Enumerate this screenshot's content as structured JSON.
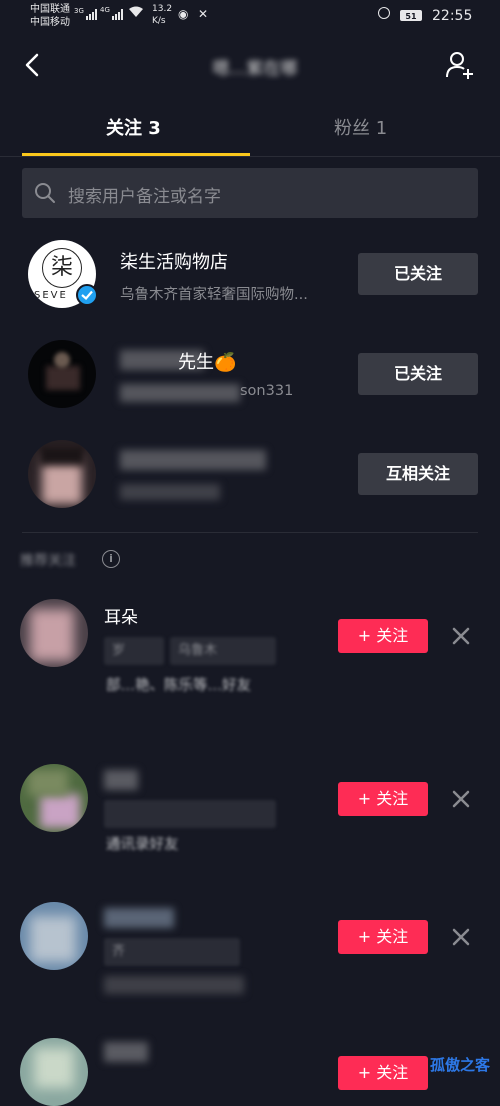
{
  "status_bar": {
    "carrier_1": "中国联通",
    "carrier_2": "中国移动",
    "net_1": "3G",
    "net_2": "4G",
    "speed_value": "13.2",
    "speed_unit": "K/s",
    "battery": "51",
    "time": "22:55"
  },
  "header": {
    "title": "嗯…紫在哪"
  },
  "tabs": {
    "following": "关注 3",
    "fans": "粉丝 1"
  },
  "search": {
    "placeholder": "搜索用户备注或名字"
  },
  "following": [
    {
      "name": "柒生活购物店",
      "subtitle": "乌鲁木齐首家轻奢国际购物...",
      "avatar_text": "柒",
      "avatar_caption": "SEVE",
      "verified": true,
      "button": "已关注"
    },
    {
      "name": "先生🍊",
      "subtitle": "son331",
      "button": "已关注"
    },
    {
      "name": "",
      "subtitle": "",
      "button": "互相关注"
    }
  ],
  "recommend": {
    "title": "推荐关注",
    "info_icon": "info-icon",
    "items": [
      {
        "name": "耳朵",
        "tags": [
          "岁",
          "乌鲁木"
        ],
        "desc": "部…艳、陈乐等…好友",
        "button": "+ 关注"
      },
      {
        "name": "",
        "tags": [
          ""
        ],
        "desc": "通讯录好友",
        "button": "+ 关注"
      },
      {
        "name": "",
        "tags": [
          "齐"
        ],
        "desc": "",
        "button": "+ 关注"
      },
      {
        "name": "",
        "tags": [],
        "desc": "",
        "button": "+ 关注"
      }
    ]
  },
  "watermark": "孤傲之客",
  "colors": {
    "background": "#161823",
    "accent_yellow": "#fbc81c",
    "follow_red": "#fe2c55",
    "button_gray": "#393b44",
    "verified_blue": "#20a0f0"
  }
}
